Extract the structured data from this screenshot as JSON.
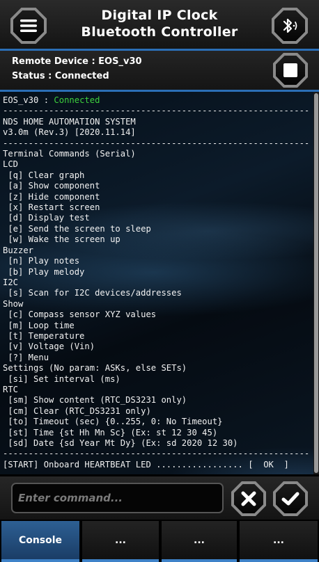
{
  "header": {
    "title_line1": "Digital IP Clock",
    "title_line2": "Bluetooth Controller",
    "menu_icon": "hamburger-menu-icon",
    "bluetooth_icon": "bluetooth-audio-icon"
  },
  "device": {
    "remote_label": "Remote Device : EOS_v30",
    "status_label": "Status : Connected",
    "stop_icon": "stop-icon"
  },
  "terminal": {
    "device_name": "EOS_v30",
    "separator": " : ",
    "state": "Connected",
    "lines": [
      "------------------------------------------------------------",
      "NDS HOME AUTOMATION SYSTEM",
      "v3.0m (Rev.3) [2020.11.14]",
      "------------------------------------------------------------",
      "Terminal Commands (Serial)",
      "LCD",
      " [q] Clear graph",
      " [a] Show component",
      " [z] Hide component",
      " [x] Restart screen",
      " [d] Display test",
      " [e] Send the screen to sleep",
      " [w] Wake the screen up",
      "Buzzer",
      " [n] Play notes",
      " [b] Play melody",
      "I2C",
      " [s] Scan for I2C devices/addresses",
      "Show",
      " [c] Compass sensor XYZ values",
      " [m] Loop time",
      " [t] Temperature",
      " [v] Voltage (Vin)",
      " [?] Menu",
      "Settings (No param: ASKs, else SETs)",
      " [si] Set interval (ms)",
      "RTC",
      " [sm] Show content (RTC_DS3231 only)",
      " [cm] Clear (RTC_DS3231 only)",
      " [to] Timeout (sec) {0..255, 0: No Timeout}",
      " [st] Time {st Hh Mn Sc} (Ex: st 12 30 45)",
      " [sd] Date {sd Year Mt Dy} (Ex: sd 2020 12 30)",
      "------------------------------------------------------------",
      "[START] Onboard HEARTBEAT LED ................. [  OK  ]"
    ]
  },
  "command": {
    "placeholder": "Enter command...",
    "value": "",
    "clear_icon": "close-icon",
    "send_icon": "checkmark-icon"
  },
  "tabs": [
    {
      "label": "Console",
      "active": true
    },
    {
      "label": "...",
      "active": false
    },
    {
      "label": "...",
      "active": false
    },
    {
      "label": "...",
      "active": false
    }
  ],
  "colors": {
    "accent": "#2b6fb6",
    "connected": "#3dd13d",
    "active_tab": "#2d5f93"
  }
}
